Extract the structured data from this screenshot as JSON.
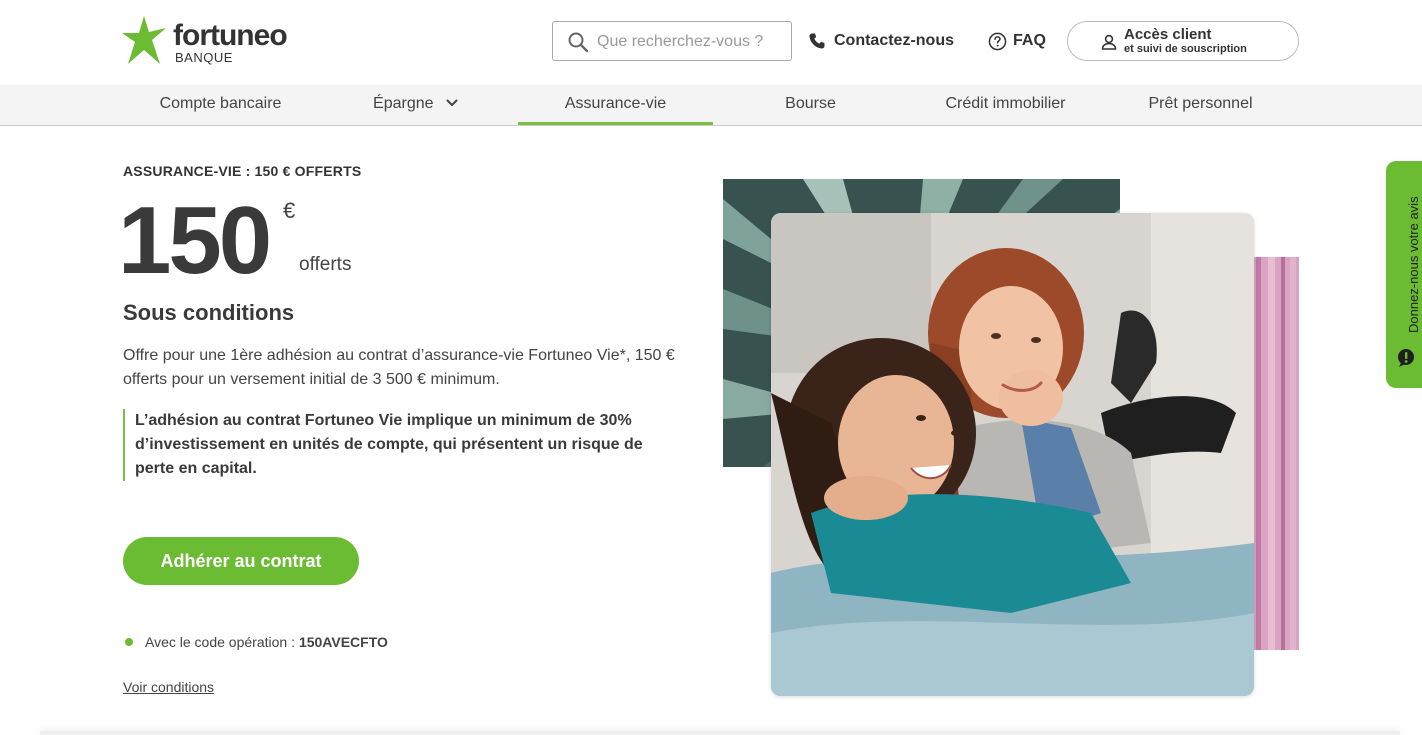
{
  "header": {
    "logo_word": "fortuneo",
    "logo_sub": "BANQUE",
    "search_placeholder": "Que recherchez-vous ?",
    "contact_label": "Contactez-nous",
    "faq_label": "FAQ",
    "acces_label": "Accès client",
    "acces_sub": "et suivi de souscription"
  },
  "nav": {
    "items": [
      {
        "label": "Compte bancaire"
      },
      {
        "label": "Épargne"
      },
      {
        "label": "Assurance-vie"
      },
      {
        "label": "Bourse"
      },
      {
        "label": "Crédit immobilier"
      },
      {
        "label": "Prêt personnel"
      }
    ],
    "active": "Assurance-vie"
  },
  "main": {
    "eyebrow": "ASSURANCE-VIE : 150 € OFFERTS",
    "amount": "150",
    "currency": "€",
    "offerts": "offerts",
    "conditions_title": "Sous conditions",
    "offer_text": "Offre pour une 1ère adhésion au contrat d’assurance-vie Fortuneo Vie*, 150 € offerts pour un versement initial de 3 500 € minimum.",
    "warning": "L’adhésion au contrat Fortuneo Vie implique un minimum de 30% d’investissement en unités de compte, qui présentent un risque de perte en capital.",
    "cta_label": "Adhérer au contrat",
    "code_prefix": "Avec le code opération :",
    "code_value": "150AVECFTO",
    "voir_conditions": "Voir conditions"
  },
  "feedback": {
    "label": "Donnez-nous votre avis"
  },
  "colors": {
    "brand_green": "#6cbc33",
    "text_dark": "#333333",
    "nav_bg": "#f4f4f4"
  }
}
